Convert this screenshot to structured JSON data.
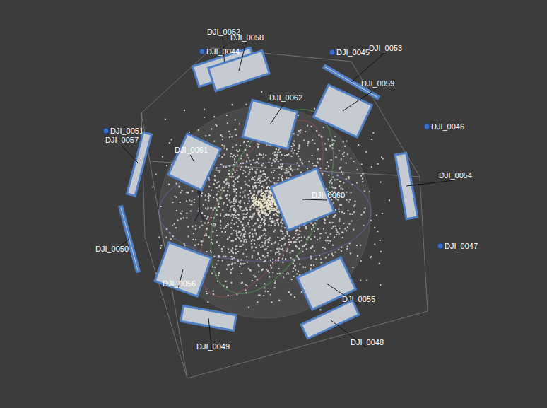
{
  "view": {
    "kind": "3d-reconstruction-viewer"
  },
  "cameras": [
    {
      "label": "DJI_0052",
      "aligned": true
    },
    {
      "label": "DJI_0058",
      "aligned": true
    },
    {
      "label": "DJI_0044",
      "aligned": false
    },
    {
      "label": "DJI_0045",
      "aligned": false
    },
    {
      "label": "DJI_0053",
      "aligned": true
    },
    {
      "label": "DJI_0059",
      "aligned": true
    },
    {
      "label": "DJI_0062",
      "aligned": true
    },
    {
      "label": "DJI_0046",
      "aligned": false
    },
    {
      "label": "DJI_0051",
      "aligned": false
    },
    {
      "label": "DJI_0057",
      "aligned": true
    },
    {
      "label": "DJI_0061",
      "aligned": true
    },
    {
      "label": "DJI_0054",
      "aligned": true
    },
    {
      "label": "DJI_0060",
      "aligned": true
    },
    {
      "label": "DJI_0050",
      "aligned": true
    },
    {
      "label": "DJI_0047",
      "aligned": false
    },
    {
      "label": "DJI_0056",
      "aligned": true
    },
    {
      "label": "DJI_0055",
      "aligned": true
    },
    {
      "label": "DJI_0049",
      "aligned": true
    },
    {
      "label": "DJI_0048",
      "aligned": true
    }
  ]
}
